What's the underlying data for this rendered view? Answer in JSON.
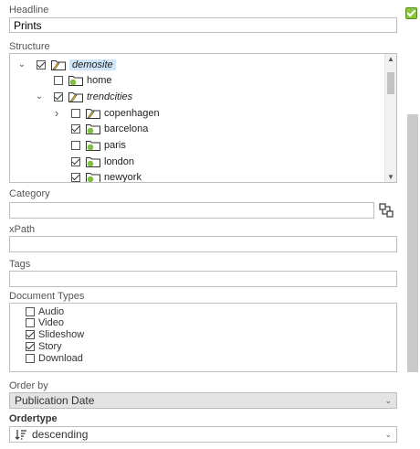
{
  "headline": {
    "label": "Headline",
    "value": "Prints"
  },
  "structure": {
    "label": "Structure",
    "items": [
      {
        "name": "demosite",
        "checked": true,
        "expanded": true,
        "level": 0,
        "selected": true,
        "italic": true
      },
      {
        "name": "home",
        "checked": false,
        "level": 1
      },
      {
        "name": "trendcities",
        "checked": true,
        "expanded": true,
        "level": 1,
        "italic": true
      },
      {
        "name": "copenhagen",
        "checked": false,
        "collapsed": true,
        "level": 2
      },
      {
        "name": "barcelona",
        "checked": true,
        "level": 2
      },
      {
        "name": "paris",
        "checked": false,
        "level": 2
      },
      {
        "name": "london",
        "checked": true,
        "level": 2
      },
      {
        "name": "newyork",
        "checked": true,
        "level": 2
      }
    ]
  },
  "category": {
    "label": "Category",
    "value": ""
  },
  "xpath": {
    "label": "xPath",
    "value": ""
  },
  "tags": {
    "label": "Tags",
    "value": ""
  },
  "document_types": {
    "label": "Document Types",
    "items": [
      {
        "name": "Audio",
        "checked": false
      },
      {
        "name": "Video",
        "checked": false
      },
      {
        "name": "Slideshow",
        "checked": true
      },
      {
        "name": "Story",
        "checked": true
      },
      {
        "name": "Download",
        "checked": false
      }
    ]
  },
  "order_by": {
    "label": "Order by",
    "value": "Publication Date"
  },
  "ordertype": {
    "label": "Ordertype",
    "value": "descending"
  },
  "colors": {
    "selected_bg": "#cfe4f7",
    "folder_yellow": "#f5c518",
    "green_badge": "#7cc242"
  },
  "icons": {
    "tree_expand": "chevron-down-icon",
    "tree_collapse": "chevron-right-icon"
  }
}
